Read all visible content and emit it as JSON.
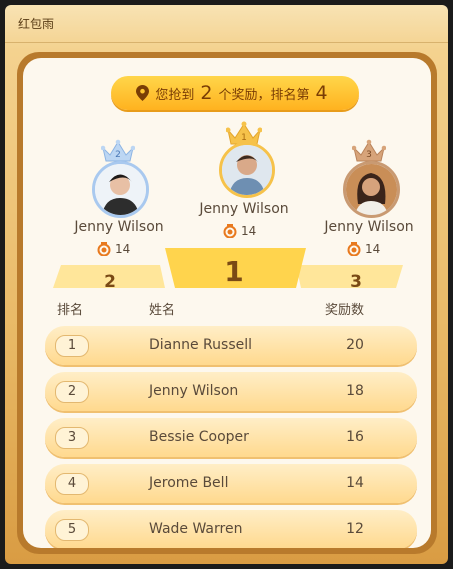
{
  "window": {
    "title": "红包雨"
  },
  "banner": {
    "prefix": "您抢到",
    "count": "2",
    "middle": "个奖励，排名第",
    "rank": "4",
    "icon": "location-pin-icon"
  },
  "podium": {
    "first": {
      "rank": "1",
      "name": "Jenny Wilson",
      "score": "14"
    },
    "second": {
      "rank": "2",
      "name": "Jenny Wilson",
      "score": "14"
    },
    "third": {
      "rank": "3",
      "name": "Jenny Wilson",
      "score": "14"
    }
  },
  "table": {
    "headers": {
      "rank": "排名",
      "name": "姓名",
      "reward": "奖励数"
    },
    "rows": [
      {
        "rank": "1",
        "name": "Dianne Russell",
        "score": "20"
      },
      {
        "rank": "2",
        "name": "Jenny Wilson",
        "score": "18"
      },
      {
        "rank": "3",
        "name": "Bessie Cooper",
        "score": "16"
      },
      {
        "rank": "4",
        "name": "Jerome Bell",
        "score": "14"
      },
      {
        "rank": "5",
        "name": "Wade Warren",
        "score": "12"
      }
    ]
  },
  "colors": {
    "accent": "#ffb21f",
    "panel_border": "#b87a2c",
    "text": "#5a4a3a"
  }
}
